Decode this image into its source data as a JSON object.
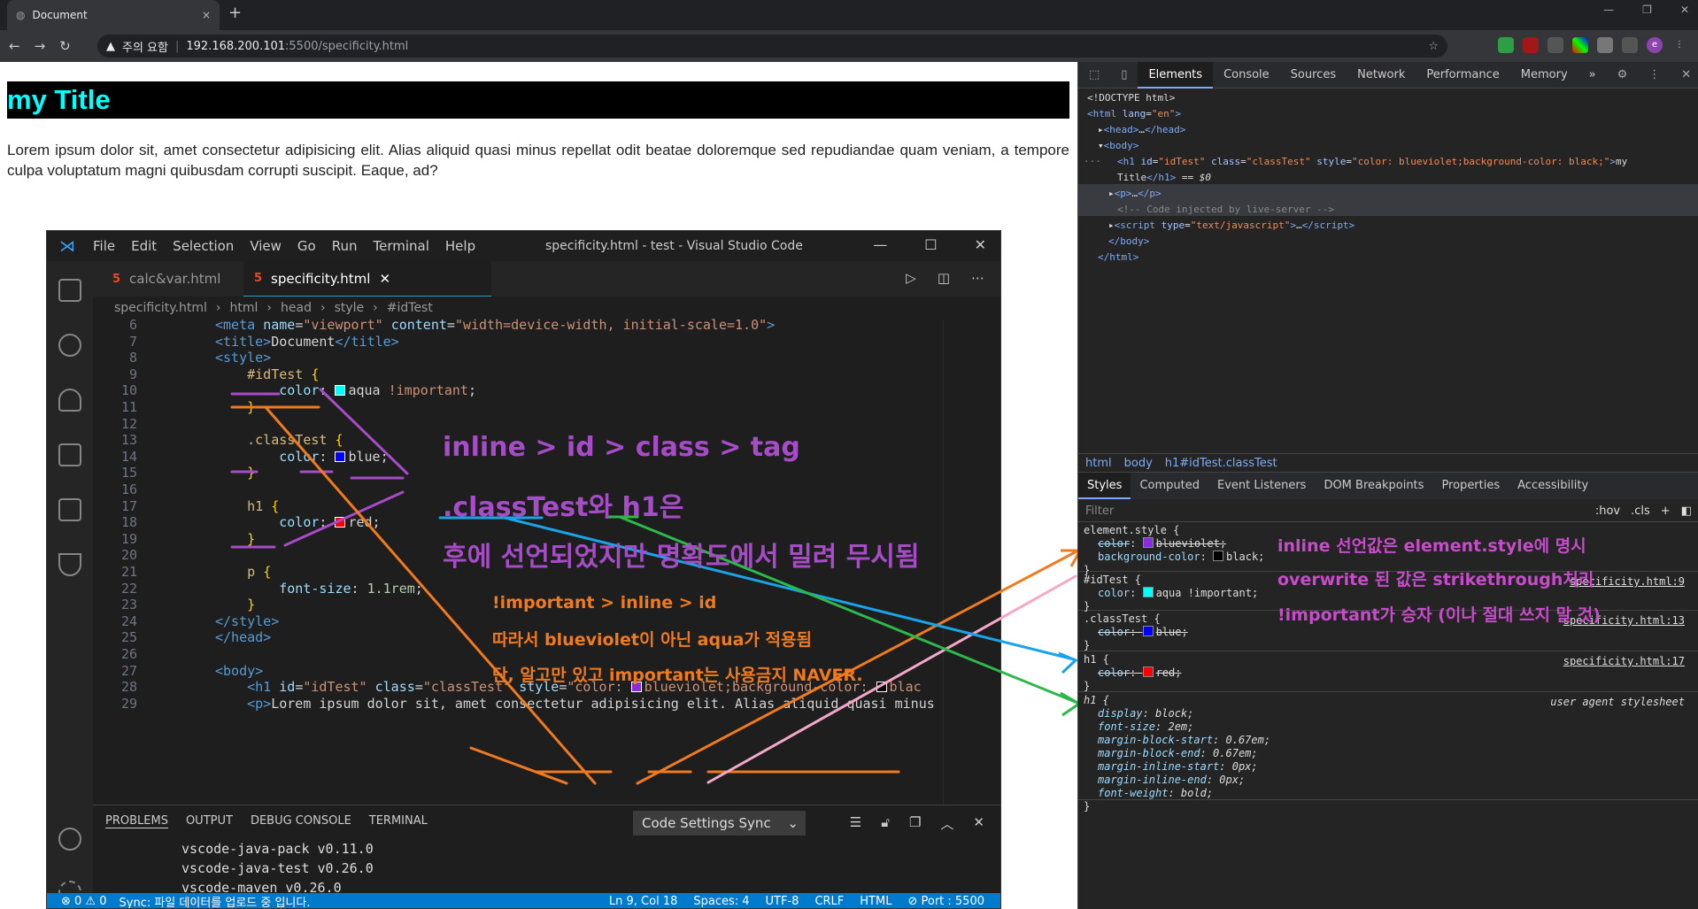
{
  "browser": {
    "tab_title": "Document",
    "tab_close": "×",
    "new_tab": "+",
    "security_label": "주의 요함",
    "url_host": "192.168.200.101",
    "url_path": ":5500/specificity.html",
    "ext_profile": "e"
  },
  "page": {
    "heading": "my Title",
    "paragraph": "Lorem ipsum dolor sit, amet consectetur adipisicing elit. Alias aliquid quasi minus repellat odit beatae doloremque sed repudiandae quam veniam, a tempore culpa voluptatum magni quibusdam corrupti suscipit. Eaque, ad?"
  },
  "vscode": {
    "menu": [
      "File",
      "Edit",
      "Selection",
      "View",
      "Go",
      "Run",
      "Terminal",
      "Help"
    ],
    "title": "specificity.html - test - Visual Studio Code",
    "tabs": [
      {
        "label": "calc&var.html"
      },
      {
        "label": "specificity.html"
      }
    ],
    "breadcrumbs": [
      "specificity.html",
      "html",
      "head",
      "style",
      "#idTest"
    ],
    "code_lines": [
      {
        "n": "6",
        "html": "<span class='tg'>&lt;meta</span> <span class='at'>name</span>=<span class='st'>\"viewport\"</span> <span class='at'>content</span>=<span class='st'>\"width=device-width, initial-scale=1.0\"</span><span class='tg'>&gt;</span>"
      },
      {
        "n": "7",
        "html": "<span class='tg'>&lt;title&gt;</span>Document<span class='tg'>&lt;/title&gt;</span>"
      },
      {
        "n": "8",
        "html": "<span class='tg'>&lt;style&gt;</span>"
      },
      {
        "n": "9",
        "html": "    <span class='sel'>#idTest</span> <span class='br'>{</span>"
      },
      {
        "n": "10",
        "html": "        <span class='pr'>color</span>: <span class='sw' style='background:aqua'></span>aqua <span class='st'>!important</span>;"
      },
      {
        "n": "11",
        "html": "    <span class='br'>}</span>"
      },
      {
        "n": "12",
        "html": ""
      },
      {
        "n": "13",
        "html": "    <span class='sel'>.classTest</span> <span class='br'>{</span>"
      },
      {
        "n": "14",
        "html": "        <span class='pr'>color</span>: <span class='sw' style='background:blue'></span>blue;"
      },
      {
        "n": "15",
        "html": "    <span class='br'>}</span>"
      },
      {
        "n": "16",
        "html": ""
      },
      {
        "n": "17",
        "html": "    <span class='sel'>h1</span> <span class='br'>{</span>"
      },
      {
        "n": "18",
        "html": "        <span class='pr'>color</span>: <span class='sw' style='background:red'></span>red;"
      },
      {
        "n": "19",
        "html": "    <span class='br'>}</span>"
      },
      {
        "n": "20",
        "html": ""
      },
      {
        "n": "21",
        "html": "    <span class='sel'>p</span> <span class='br'>{</span>"
      },
      {
        "n": "22",
        "html": "        <span class='pr'>font-size</span>: <span class='nu'>1.1rem</span>;"
      },
      {
        "n": "23",
        "html": "    <span class='br'>}</span>"
      },
      {
        "n": "24",
        "html": "<span class='tg'>&lt;/style&gt;</span>"
      },
      {
        "n": "25",
        "html": "<span class='tg'>&lt;/head&gt;</span>"
      },
      {
        "n": "26",
        "html": ""
      },
      {
        "n": "27",
        "html": "<span class='tg'>&lt;body&gt;</span>"
      },
      {
        "n": "28",
        "html": "    <span class='tg'>&lt;h1</span> <span class='at'>id</span>=<span class='st'>\"idTest\"</span> <span class='at'>class</span>=<span class='st'>\"classTest\"</span> <span class='at'>style</span>=<span class='st'>\"color: </span><span class='sw' style='background:blueviolet'></span><span class='st'>blueviolet;background-color: </span><span class='sw' style='background:black'></span><span class='st'>blac</span>"
      },
      {
        "n": "29",
        "html": "    <span class='tg'>&lt;p&gt;</span>Lorem ipsum dolor sit, amet consectetur adipisicing elit. Alias aliquid quasi minus"
      }
    ],
    "panel_tabs": [
      "PROBLEMS",
      "OUTPUT",
      "DEBUG CONSOLE",
      "TERMINAL"
    ],
    "panel_select": "Code Settings Sync",
    "panel_output": [
      "vscode-java-pack v0.11.0",
      "vscode-java-test v0.26.0",
      "vscode-maven v0.26.0"
    ],
    "status_left": [
      "⊗ 0 ⚠ 0",
      "Sync: 파일 데이터를 업로드 중 입니다."
    ],
    "status_right": [
      "Ln 9, Col 18",
      "Spaces: 4",
      "UTF-8",
      "CRLF",
      "HTML",
      "⊘ Port : 5500"
    ]
  },
  "annotations": {
    "rule": "inline > id > class > tag",
    "class_h1": ".classTest와 h1은",
    "ignored": "후에 선언되었지만 명확도에서 밀려 무시됨",
    "important1": "!important > inline > id",
    "important2": "따라서 blueviolet이 아닌 aqua가 적용됨",
    "important3": "단, 알고만 있고 important는 사용금지 NAVER.",
    "inline1": "inline 선언값은 element.style에 명시",
    "inline2": "overwrite 된 값은 strikethrough처리",
    "inline3": "!important가 승자 (이나 절대 쓰지 말 것)"
  },
  "devtools": {
    "tabs": [
      "Elements",
      "Console",
      "Sources",
      "Network",
      "Performance",
      "Memory",
      "»"
    ],
    "crumbs": [
      "html",
      "body",
      "h1#idTest.classTest"
    ],
    "style_tabs": [
      "Styles",
      "Computed",
      "Event Listeners",
      "DOM Breakpoints",
      "Properties",
      "Accessibility"
    ],
    "filter_placeholder": "Filter",
    "filter_hov": ":hov",
    "filter_cls": ".cls",
    "src_id": "specificity.html:9",
    "src_class": "specificity.html:13",
    "src_h1": "specificity.html:17",
    "ua_label": "user agent stylesheet"
  }
}
